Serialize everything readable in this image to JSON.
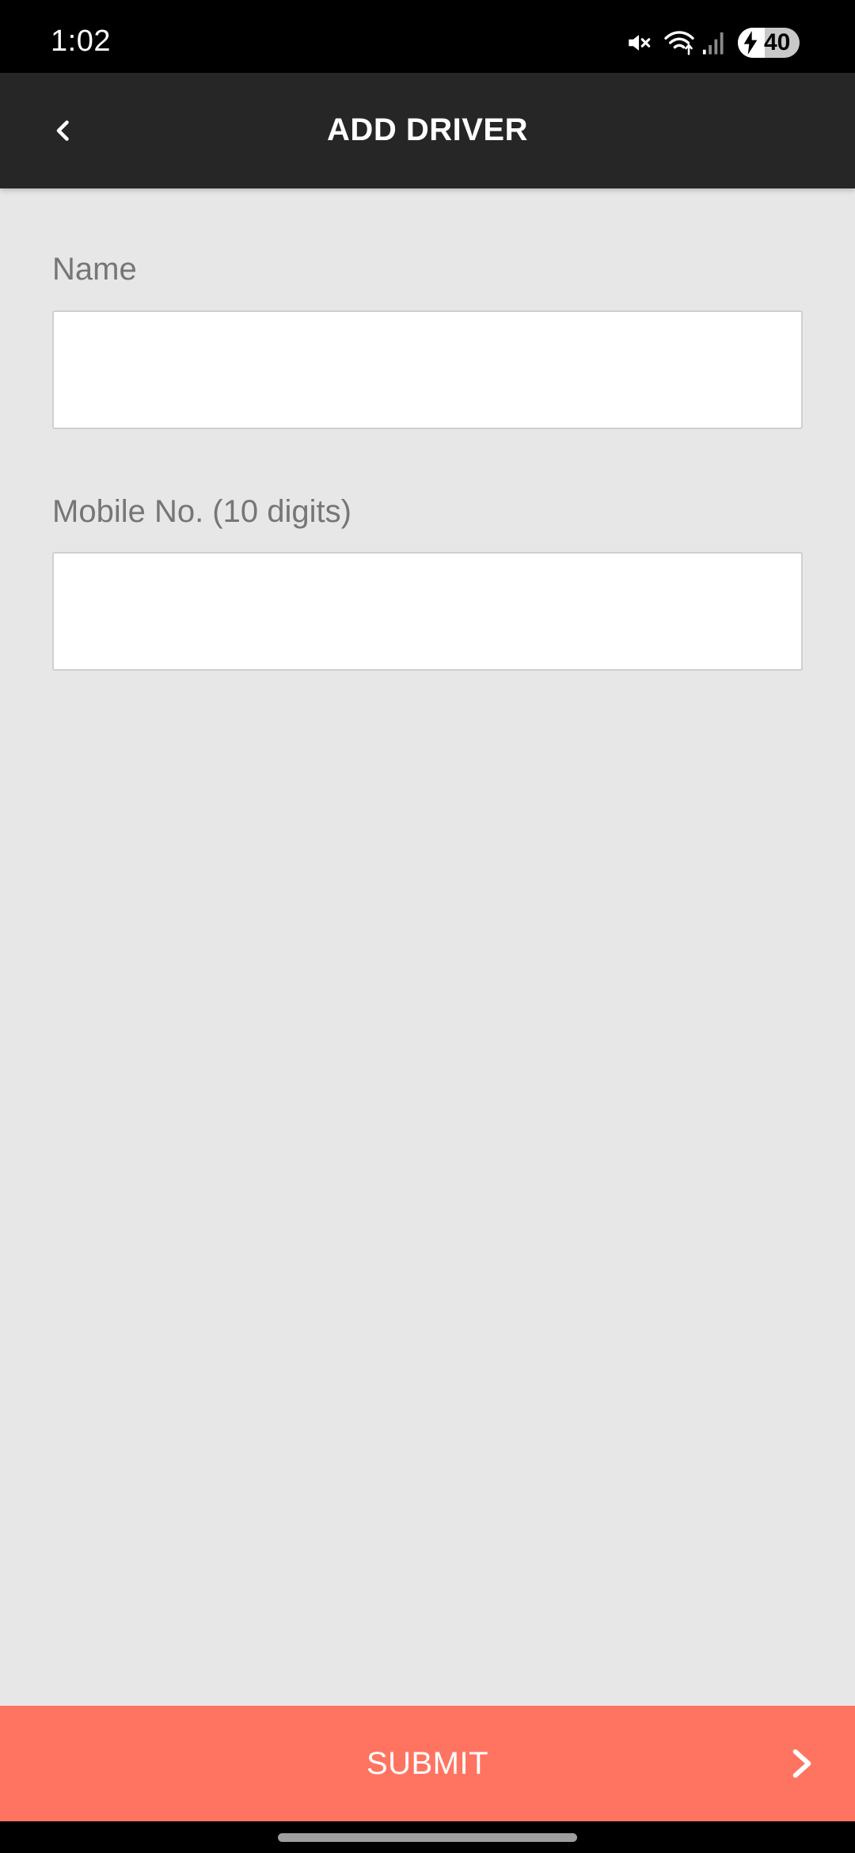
{
  "status_bar": {
    "time": "1:02",
    "battery_level": "40",
    "icons": [
      "mute-icon",
      "wifi-icon",
      "signal-icon",
      "battery-charging-icon"
    ]
  },
  "header": {
    "title": "ADD DRIVER",
    "back_icon": "chevron-left-icon"
  },
  "form": {
    "name": {
      "label": "Name",
      "value": "",
      "placeholder": ""
    },
    "mobile": {
      "label": "Mobile No. (10 digits)",
      "value": "",
      "placeholder": ""
    }
  },
  "footer": {
    "submit_label": "SUBMIT",
    "submit_icon": "chevron-right-icon"
  },
  "colors": {
    "status_bar_bg": "#000000",
    "app_bar_bg": "#262626",
    "page_bg": "#e7e7e7",
    "accent": "#ff7461",
    "label_text": "#767676"
  }
}
